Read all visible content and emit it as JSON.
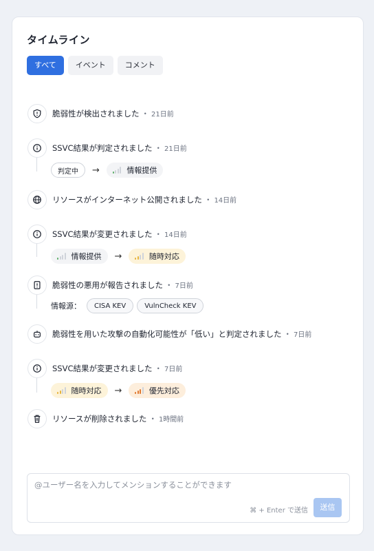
{
  "title": "タイムライン",
  "tabs": [
    {
      "label": "すべて",
      "active": true
    },
    {
      "label": "イベント",
      "active": false
    },
    {
      "label": "コメント",
      "active": false
    }
  ],
  "events": [
    {
      "icon": "shield-icon",
      "text": "脆弱性が検出されました",
      "time": "21日前"
    },
    {
      "icon": "info-icon",
      "text": "SSVC結果が判定されました",
      "time": "21日前",
      "from": {
        "label": "判定中",
        "level": "pending"
      },
      "to": {
        "label": "情報提供",
        "level": "track"
      }
    },
    {
      "icon": "globe-icon",
      "text": "リソースがインターネット公開されました",
      "time": "14日前"
    },
    {
      "icon": "info-icon",
      "text": "SSVC結果が変更されました",
      "time": "14日前",
      "from": {
        "label": "情報提供",
        "level": "track"
      },
      "to": {
        "label": "随時対応",
        "level": "attend"
      }
    },
    {
      "icon": "report-icon",
      "text": "脆弱性の悪用が報告されました",
      "time": "7日前",
      "sources_label": "情報源：",
      "sources": [
        "CISA KEV",
        "VulnCheck KEV"
      ]
    },
    {
      "icon": "robot-icon",
      "text": "脆弱性を用いた攻撃の自動化可能性が「低い」と判定されました",
      "time": "7日前"
    },
    {
      "icon": "info-icon",
      "text": "SSVC結果が変更されました",
      "time": "7日前",
      "from": {
        "label": "随時対応",
        "level": "attend"
      },
      "to": {
        "label": "優先対応",
        "level": "act"
      }
    },
    {
      "icon": "trash-icon",
      "text": "リソースが削除されました",
      "time": "1時間前"
    }
  ],
  "arrow": "→",
  "separator": "・",
  "composer": {
    "placeholder": "@ユーザー名を入力してメンションすることができます",
    "hint": "⌘ + Enter で送信",
    "send_label": "送信"
  },
  "colors": {
    "accent": "#2f6fe0",
    "send_disabled": "#a9c6f2",
    "bar_inactive": "#cfd3da",
    "bar_track": "#5fae6b",
    "bar_attend": "#e6b43c",
    "bar_act": "#e0782f"
  }
}
